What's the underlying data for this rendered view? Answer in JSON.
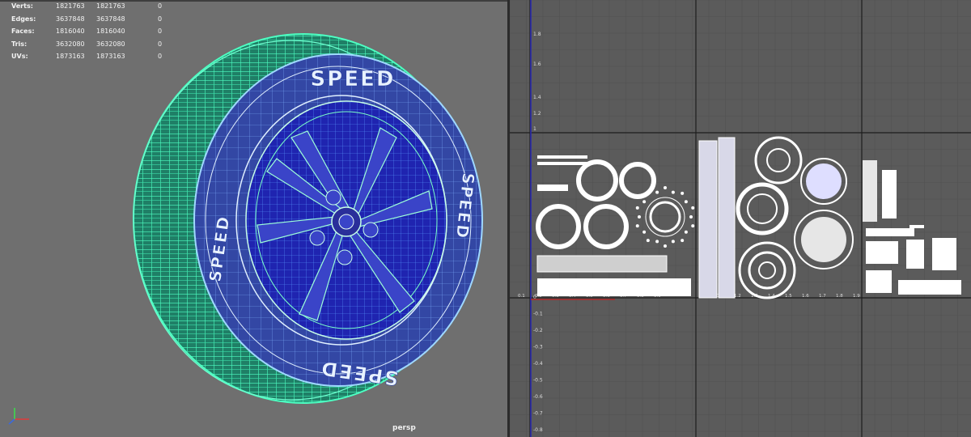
{
  "hud": {
    "rows": [
      {
        "label": "Verts:",
        "v1": "1821763",
        "v2": "1821763",
        "v3": "0"
      },
      {
        "label": "Edges:",
        "v1": "3637848",
        "v2": "3637848",
        "v3": "0"
      },
      {
        "label": "Faces:",
        "v1": "1816040",
        "v2": "1816040",
        "v3": "0"
      },
      {
        "label": "Tris:",
        "v1": "3632080",
        "v2": "3632080",
        "v3": "0"
      },
      {
        "label": "UVs:",
        "v1": "1873163",
        "v2": "1873163",
        "v3": "0"
      }
    ]
  },
  "viewport": {
    "camera_label": "persp",
    "tire_text_top": "SPEED",
    "tire_text_bottom": "SPEED",
    "tire_text_left": "SPEED",
    "tire_text_right": "SPEED",
    "wireframe_color": "#3cf0b0",
    "mesh_color": "#2a3fc8"
  },
  "uv_editor": {
    "v_ticks_top": [
      "1.8",
      "1.6",
      "1.4",
      "1.2",
      "1"
    ],
    "v_ticks_bottom": [
      "0",
      "-0.1",
      "-0.2",
      "-0.3",
      "-0.4",
      "-0.5",
      "-0.6",
      "-0.7",
      "-0.8"
    ],
    "u_ticks": [
      "0.1",
      "0.2",
      "0.3",
      "0.4",
      "0.5",
      "0.6",
      "0.7",
      "0.8",
      "0.9",
      "1.1",
      "1.2",
      "1.3",
      "1.4",
      "1.5",
      "1.6",
      "1.7",
      "1.8",
      "1.9"
    ],
    "axis_color": "#2a2ab0",
    "shell_color": "#ffffff"
  }
}
